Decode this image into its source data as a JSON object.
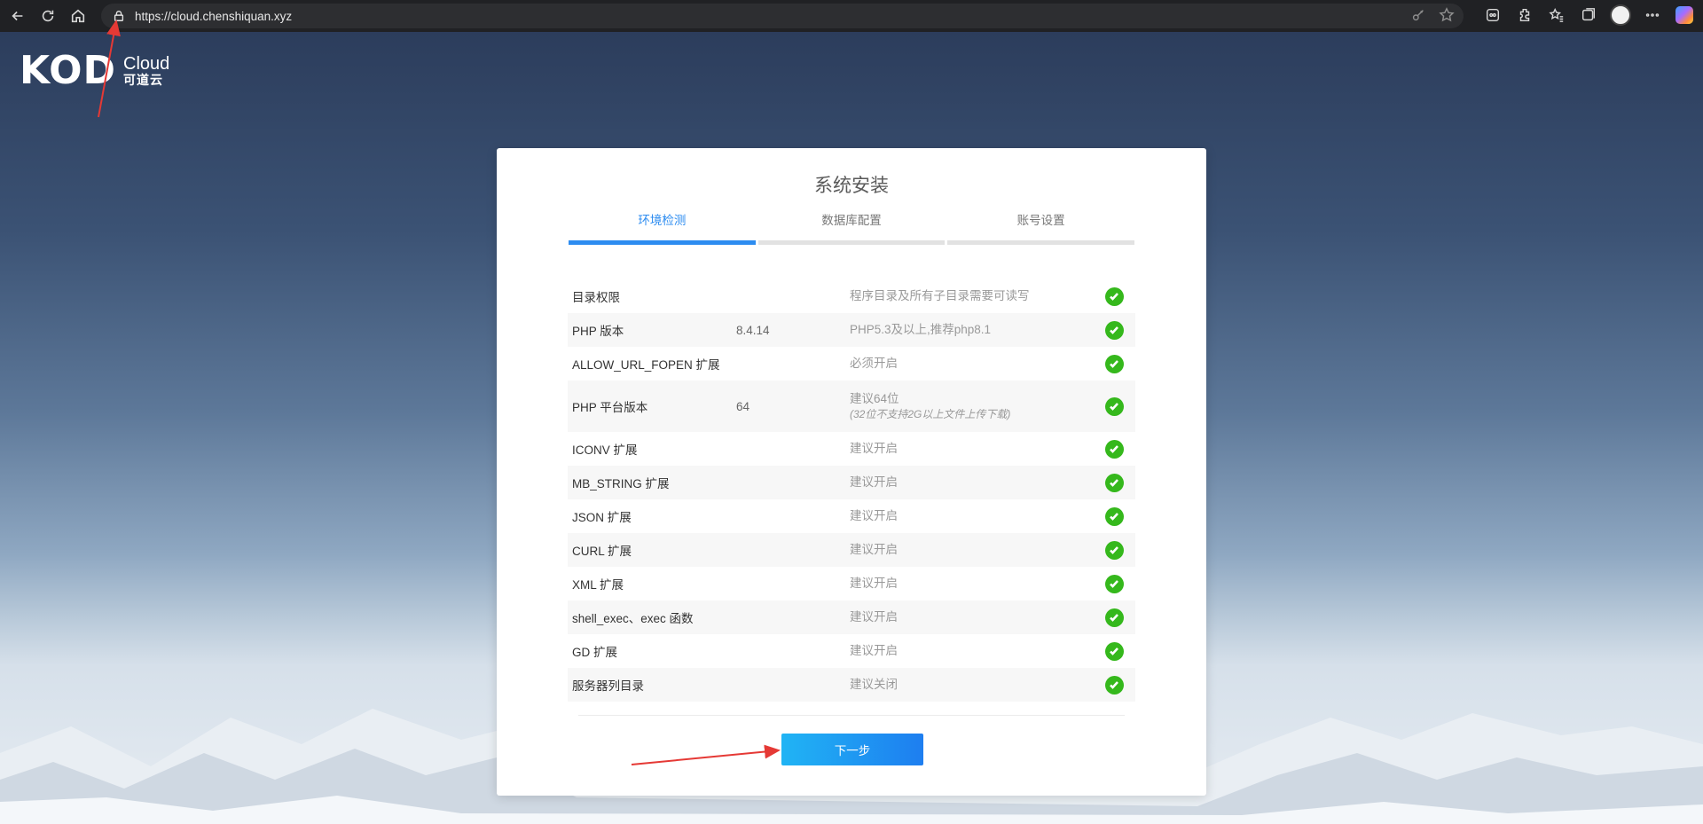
{
  "browser": {
    "url": "https://cloud.chenshiquan.xyz"
  },
  "logo": {
    "mark": "KOD",
    "brand": "Cloud",
    "brand_cn": "可道云"
  },
  "install": {
    "title": "系统安装",
    "steps": [
      {
        "label": "环境检测",
        "active": true
      },
      {
        "label": "数据库配置",
        "active": false
      },
      {
        "label": "账号设置",
        "active": false
      }
    ],
    "checks": [
      {
        "name": "目录权限",
        "value": "",
        "desc": "程序目录及所有子目录需要可读写",
        "note": "",
        "status": "ok"
      },
      {
        "name": "PHP 版本",
        "value": "8.4.14",
        "desc": "PHP5.3及以上,推荐php8.1",
        "note": "",
        "status": "ok"
      },
      {
        "name": "ALLOW_URL_FOPEN 扩展",
        "value": "",
        "desc": "必须开启",
        "note": "",
        "status": "ok"
      },
      {
        "name": "PHP 平台版本",
        "value": "64",
        "desc": "建议64位",
        "note": "(32位不支持2G以上文件上传下载)",
        "status": "ok"
      },
      {
        "name": "ICONV 扩展",
        "value": "",
        "desc": "建议开启",
        "note": "",
        "status": "ok"
      },
      {
        "name": "MB_STRING 扩展",
        "value": "",
        "desc": "建议开启",
        "note": "",
        "status": "ok"
      },
      {
        "name": "JSON 扩展",
        "value": "",
        "desc": "建议开启",
        "note": "",
        "status": "ok"
      },
      {
        "name": "CURL 扩展",
        "value": "",
        "desc": "建议开启",
        "note": "",
        "status": "ok"
      },
      {
        "name": "XML 扩展",
        "value": "",
        "desc": "建议开启",
        "note": "",
        "status": "ok"
      },
      {
        "name": "shell_exec、exec 函数",
        "value": "",
        "desc": "建议开启",
        "note": "",
        "status": "ok"
      },
      {
        "name": "GD 扩展",
        "value": "",
        "desc": "建议开启",
        "note": "",
        "status": "ok"
      },
      {
        "name": "服务器列目录",
        "value": "",
        "desc": "建议关闭",
        "note": "",
        "status": "ok"
      }
    ],
    "next_label": "下一步"
  },
  "colors": {
    "accent": "#2d8cf0",
    "ok": "#35b81c",
    "annotation": "#e53935"
  }
}
